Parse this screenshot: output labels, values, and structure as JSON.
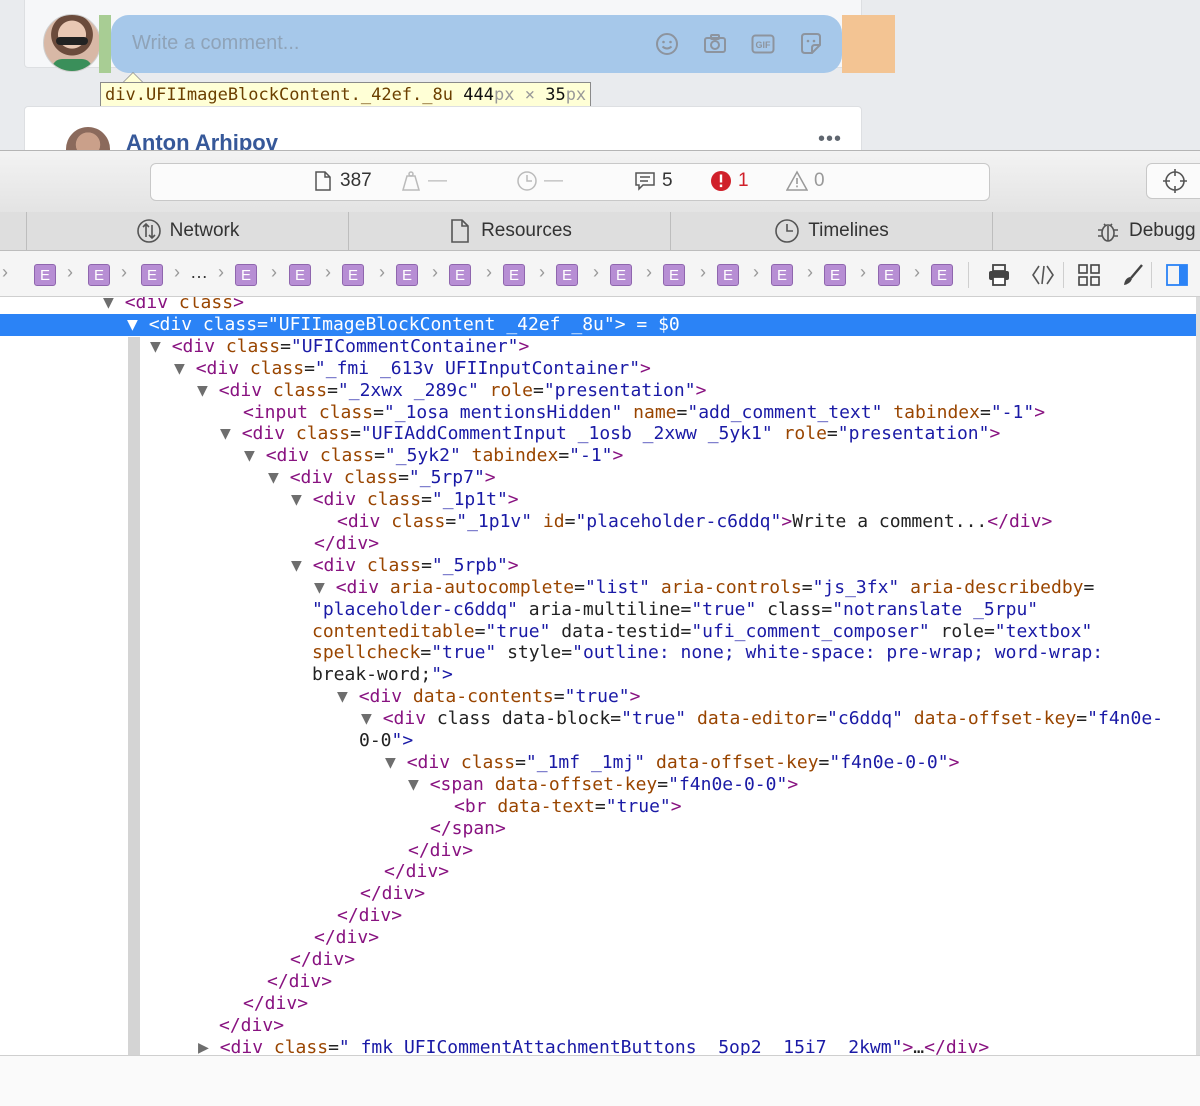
{
  "composer": {
    "placeholder": "Write a comment...",
    "icons": [
      "emoji-icon",
      "camera-icon",
      "gif-icon",
      "sticker-icon"
    ]
  },
  "tooltip": {
    "selector": "div.UFIImageBlockContent._42ef._8u",
    "width": "444",
    "times": "×",
    "height": "35",
    "unit": "px"
  },
  "next_post": {
    "author": "Anton Arhipov",
    "more": "•••"
  },
  "activity": {
    "resources_count": "387",
    "load_time": "—",
    "timeline_time": "—",
    "logs_count": "5",
    "errors_count": "1",
    "warnings_count": "0"
  },
  "tabs": [
    {
      "label": "Network"
    },
    {
      "label": "Resources"
    },
    {
      "label": "Timelines"
    },
    {
      "label": "Debugg"
    }
  ],
  "breadcrumb": {
    "element_badge": "E",
    "ellipsis": "…"
  },
  "dom": {
    "lines": [
      "▼ <div class>",
      "▼ <div class=\"UFIImageBlockContent _42ef _8u\"> = $0",
      "▼ <div class=\"UFICommentContainer\">",
      "▼ <div class=\"_fmi _613v UFIInputContainer\">",
      "▼ <div class=\"_2xwx _289c\" role=\"presentation\">",
      "<input class=\"_1osa mentionsHidden\" name=\"add_comment_text\" tabindex=\"-1\">",
      "▼ <div class=\"UFIAddCommentInput _1osb _2xww _5yk1\" role=\"presentation\">",
      "▼ <div class=\"_5yk2\" tabindex=\"-1\">",
      "▼ <div class=\"_5rp7\">",
      "▼ <div class=\"_1p1t\">",
      "<div class=\"_1p1v\" id=\"placeholder-c6ddq\">Write a comment...</div>",
      "</div>",
      "▼ <div class=\"_5rpb\">",
      "▼ <div aria-autocomplete=\"list\" aria-controls=\"js_3fx\" aria-describedby=",
      "\"placeholder-c6ddq\" aria-multiline=\"true\" class=\"notranslate _5rpu\"",
      "contenteditable=\"true\" data-testid=\"ufi_comment_composer\" role=\"textbox\"",
      "spellcheck=\"true\" style=\"outline: none; white-space: pre-wrap; word-wrap:",
      "break-word;\">",
      "▼ <div data-contents=\"true\">",
      "▼ <div class data-block=\"true\" data-editor=\"c6ddq\" data-offset-key=\"f4n0e-",
      "0-0\">",
      "▼ <div class=\"_1mf _1mj\" data-offset-key=\"f4n0e-0-0\">",
      "▼ <span data-offset-key=\"f4n0e-0-0\">",
      "<br data-text=\"true\">",
      "</span>",
      "</div>",
      "</div>",
      "</div>",
      "</div>",
      "</div>",
      "</div>",
      "</div>",
      "</div>",
      "</div>",
      "▶ <div class=\"_fmk UFICommentAttachmentButtons _5op2 _15i7 _2kwm\">…</div>"
    ]
  }
}
